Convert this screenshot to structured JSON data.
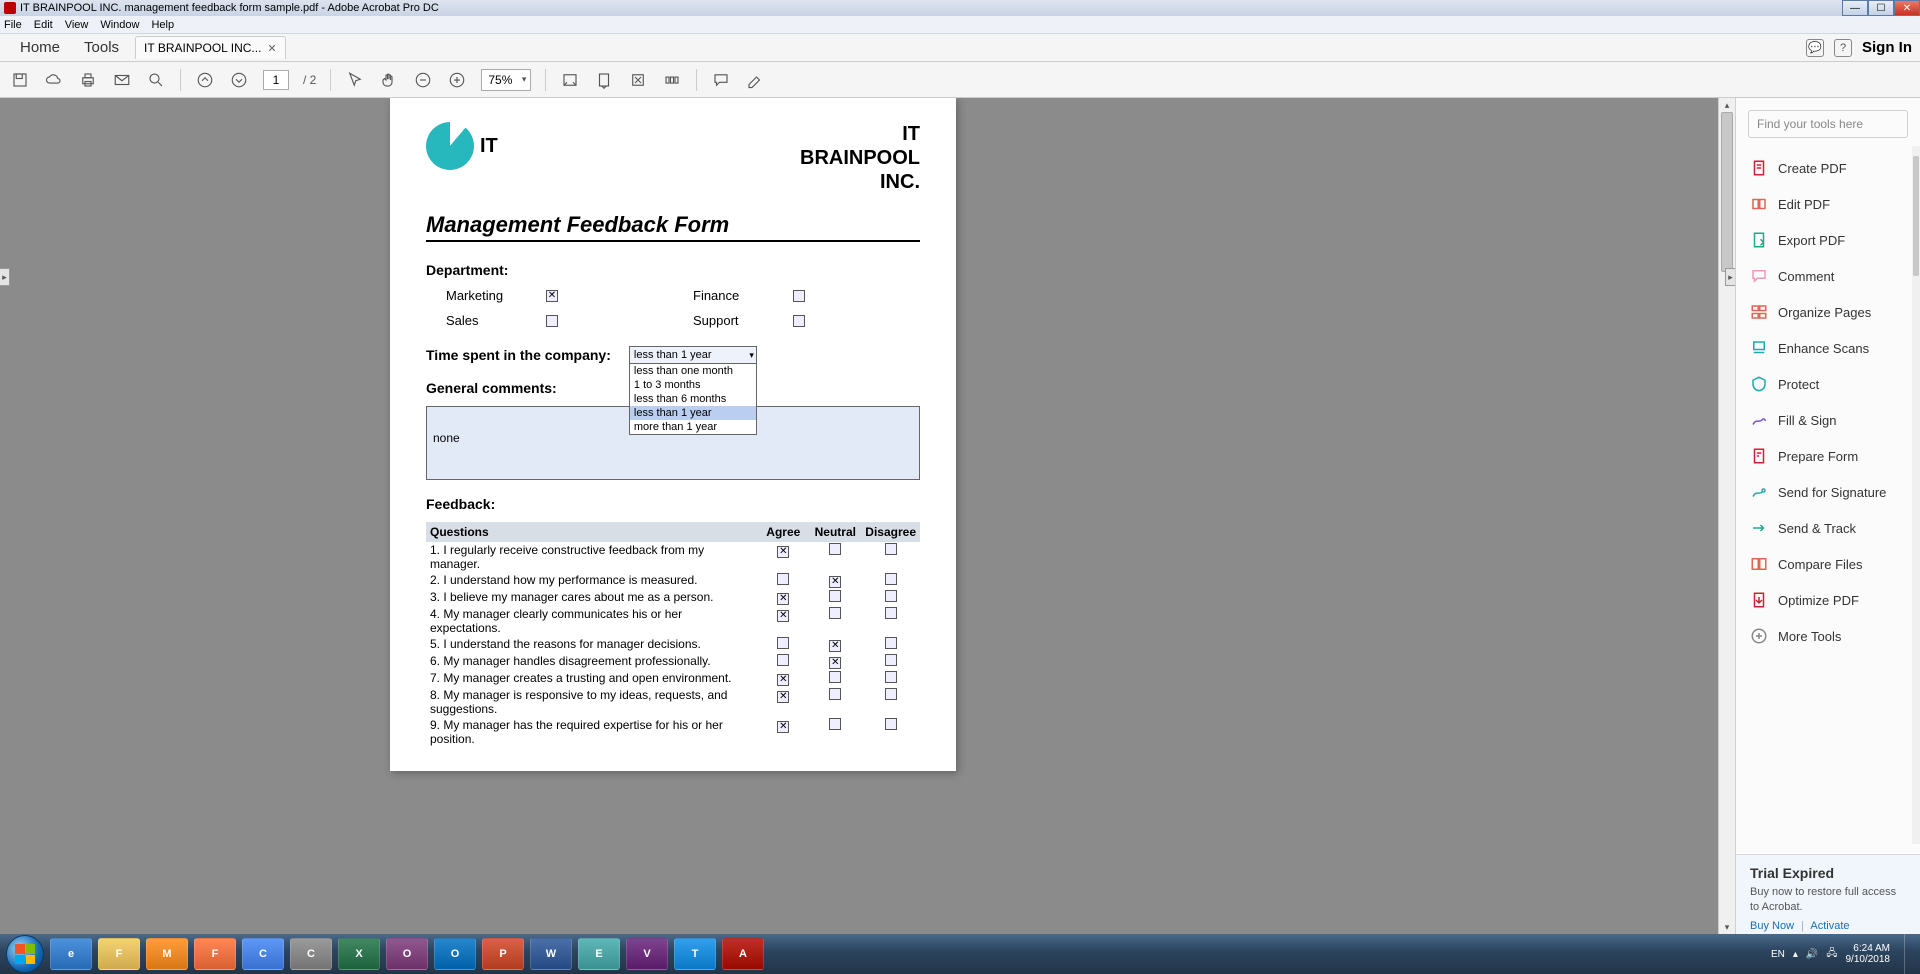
{
  "window": {
    "title": "IT BRAINPOOL INC. management feedback form sample.pdf - Adobe Acrobat Pro DC"
  },
  "menubar": [
    "File",
    "Edit",
    "View",
    "Window",
    "Help"
  ],
  "tabs": {
    "home": "Home",
    "tools": "Tools",
    "doc": "IT BRAINPOOL INC...",
    "signin": "Sign In"
  },
  "toolbar": {
    "page_current": "1",
    "page_total": "/ 2",
    "zoom": "75%"
  },
  "toolspane": {
    "search_placeholder": "Find your tools here",
    "items": [
      "Create PDF",
      "Edit PDF",
      "Export PDF",
      "Comment",
      "Organize Pages",
      "Enhance Scans",
      "Protect",
      "Fill & Sign",
      "Prepare Form",
      "Send for Signature",
      "Send & Track",
      "Compare Files",
      "Optimize PDF",
      "More Tools"
    ],
    "trial": {
      "title": "Trial Expired",
      "msg": "Buy now to restore full access to Acrobat.",
      "buy": "Buy Now",
      "activate": "Activate"
    }
  },
  "doc": {
    "logo_text": "IT",
    "company_l1": "IT",
    "company_l2": "BRAINPOOL",
    "company_l3": "INC.",
    "form_title": "Management Feedback Form",
    "dept_label": "Department:",
    "dept": {
      "marketing": "Marketing",
      "finance": "Finance",
      "sales": "Sales",
      "support": "Support"
    },
    "time_label": "Time spent in the company:",
    "time_selected": "less than 1 year",
    "time_options": [
      "less than one month",
      "1 to 3 months",
      "less than 6 months",
      "less than 1 year",
      "more than 1 year"
    ],
    "comments_label": "General comments:",
    "comments_value": "none",
    "feedback_label": "Feedback:",
    "cols": {
      "q": "Questions",
      "a": "Agree",
      "n": "Neutral",
      "d": "Disagree"
    },
    "questions": [
      {
        "t": "1. I regularly receive constructive feedback from my manager.",
        "a": true,
        "n": false,
        "d": false
      },
      {
        "t": "2. I understand how my performance is measured.",
        "a": false,
        "n": true,
        "d": false
      },
      {
        "t": "3. I believe my manager cares about me as a person.",
        "a": true,
        "n": false,
        "d": false
      },
      {
        "t": "4. My manager clearly communicates his or her expectations.",
        "a": true,
        "n": false,
        "d": false
      },
      {
        "t": "5. I understand the reasons for manager decisions.",
        "a": false,
        "n": true,
        "d": false
      },
      {
        "t": "6. My manager handles disagreement professionally.",
        "a": false,
        "n": true,
        "d": false
      },
      {
        "t": "7. My manager creates a trusting and open environment.",
        "a": true,
        "n": false,
        "d": false
      },
      {
        "t": "8. My manager is responsive to my ideas, requests, and suggestions.",
        "a": true,
        "n": false,
        "d": false
      },
      {
        "t": "9. My manager has the required expertise for his or her position.",
        "a": true,
        "n": false,
        "d": false
      }
    ]
  },
  "taskbar": {
    "apps": [
      "IE",
      "FE",
      "MP",
      "FF",
      "CH",
      "CO",
      "XL",
      "ON",
      "OL",
      "PP",
      "WD",
      "ED",
      "VS",
      "TV",
      "AC"
    ],
    "lang": "EN",
    "time": "6:24 AM",
    "date": "9/10/2018"
  },
  "tool_icon_colors": [
    "#c23",
    "#d65",
    "#2a8",
    "#e9b",
    "#d65",
    "#2aa",
    "#2aa",
    "#7a4fc7",
    "#c23",
    "#2aa",
    "#2a8",
    "#d65",
    "#c23",
    "#888"
  ]
}
